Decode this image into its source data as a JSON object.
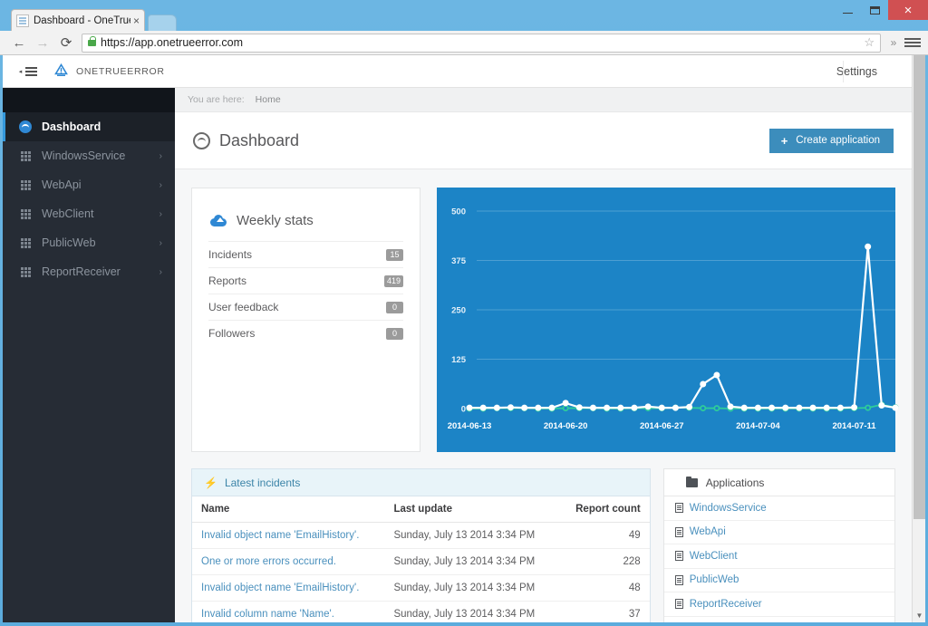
{
  "browser": {
    "tab_title": "Dashboard - OneTrueError",
    "tab_close": "×",
    "url": "https://app.onetrueerror.com",
    "back_icon": "←",
    "forward_icon": "→",
    "reload_icon": "⟳",
    "star_icon": "☆",
    "overflow_icon": "»",
    "minimize": "",
    "maximize": "",
    "close": "×"
  },
  "appnav": {
    "brand": "ONETRUEERROR",
    "settings": "Settings",
    "toggle_caret": "◂"
  },
  "sidebar": {
    "items": [
      {
        "label": "Dashboard",
        "icon": "dashboard-icon",
        "active": true,
        "chevron": ""
      },
      {
        "label": "WindowsService",
        "icon": "grid-icon",
        "active": false,
        "chevron": "›"
      },
      {
        "label": "WebApi",
        "icon": "grid-icon",
        "active": false,
        "chevron": "›"
      },
      {
        "label": "WebClient",
        "icon": "grid-icon",
        "active": false,
        "chevron": "›"
      },
      {
        "label": "PublicWeb",
        "icon": "grid-icon",
        "active": false,
        "chevron": "›"
      },
      {
        "label": "ReportReceiver",
        "icon": "grid-icon",
        "active": false,
        "chevron": "›"
      }
    ]
  },
  "breadcrumb": {
    "prefix": "You are here:",
    "current": "Home"
  },
  "page": {
    "title": "Dashboard",
    "create_button": "Create application",
    "create_plus": "+"
  },
  "weekly_stats": {
    "title": "Weekly stats",
    "rows": [
      {
        "label": "Incidents",
        "value": "15"
      },
      {
        "label": "Reports",
        "value": "419"
      },
      {
        "label": "User feedback",
        "value": "0"
      },
      {
        "label": "Followers",
        "value": "0"
      }
    ]
  },
  "chart_data": {
    "type": "line",
    "title": "",
    "xlabel": "",
    "ylabel": "",
    "ylim": [
      0,
      500
    ],
    "yticks": [
      0,
      125,
      250,
      375,
      500
    ],
    "grid": true,
    "legend": "none",
    "background_color": "#1c84c6",
    "x_tick_labels": [
      "2014-06-13",
      "2014-06-20",
      "2014-06-27",
      "2014-07-04",
      "2014-07-11"
    ],
    "x_tick_indices": [
      0,
      7,
      14,
      21,
      28
    ],
    "x": [
      "2014-06-13",
      "2014-06-14",
      "2014-06-15",
      "2014-06-16",
      "2014-06-17",
      "2014-06-18",
      "2014-06-19",
      "2014-06-20",
      "2014-06-21",
      "2014-06-22",
      "2014-06-23",
      "2014-06-24",
      "2014-06-25",
      "2014-06-26",
      "2014-06-27",
      "2014-06-28",
      "2014-06-29",
      "2014-06-30",
      "2014-07-01",
      "2014-07-02",
      "2014-07-03",
      "2014-07-04",
      "2014-07-05",
      "2014-07-06",
      "2014-07-07",
      "2014-07-08",
      "2014-07-09",
      "2014-07-10",
      "2014-07-11",
      "2014-07-12",
      "2014-07-13"
    ],
    "series": [
      {
        "name": "Reports",
        "color": "#ffffff",
        "values": [
          2,
          2,
          2,
          3,
          2,
          2,
          2,
          14,
          3,
          2,
          2,
          2,
          2,
          5,
          2,
          2,
          4,
          62,
          85,
          5,
          2,
          2,
          2,
          2,
          2,
          2,
          2,
          2,
          3,
          410,
          8,
          2
        ]
      },
      {
        "name": "Incidents",
        "color": "#2ecc9b",
        "values": [
          0,
          0,
          1,
          1,
          1,
          0,
          0,
          1,
          1,
          1,
          0,
          0,
          1,
          1,
          1,
          2,
          2,
          1,
          1,
          0,
          0,
          0,
          0,
          0,
          0,
          0,
          0,
          0,
          1,
          2,
          10,
          3
        ]
      }
    ]
  },
  "latest_incidents": {
    "title": "Latest incidents",
    "columns": [
      "Name",
      "Last update",
      "Report count"
    ],
    "rows": [
      {
        "name": "Invalid object name 'EmailHistory'.",
        "updated": "Sunday, July 13 2014 3:34 PM",
        "count": "49"
      },
      {
        "name": "One or more errors occurred.",
        "updated": "Sunday, July 13 2014 3:34 PM",
        "count": "228"
      },
      {
        "name": "Invalid object name 'EmailHistory'.",
        "updated": "Sunday, July 13 2014 3:34 PM",
        "count": "48"
      },
      {
        "name": "Invalid column name 'Name'.",
        "updated": "Sunday, July 13 2014 3:34 PM",
        "count": "37"
      }
    ]
  },
  "applications": {
    "title": "Applications",
    "items": [
      "WindowsService",
      "WebApi",
      "WebClient",
      "PublicWeb",
      "ReportReceiver"
    ]
  },
  "colors": {
    "accent": "#3c8dbc",
    "chart_bg": "#1c84c6",
    "sidebar_bg": "#262c35",
    "link": "#4a90bd",
    "series_white": "#ffffff",
    "series_green": "#2ecc9b"
  }
}
